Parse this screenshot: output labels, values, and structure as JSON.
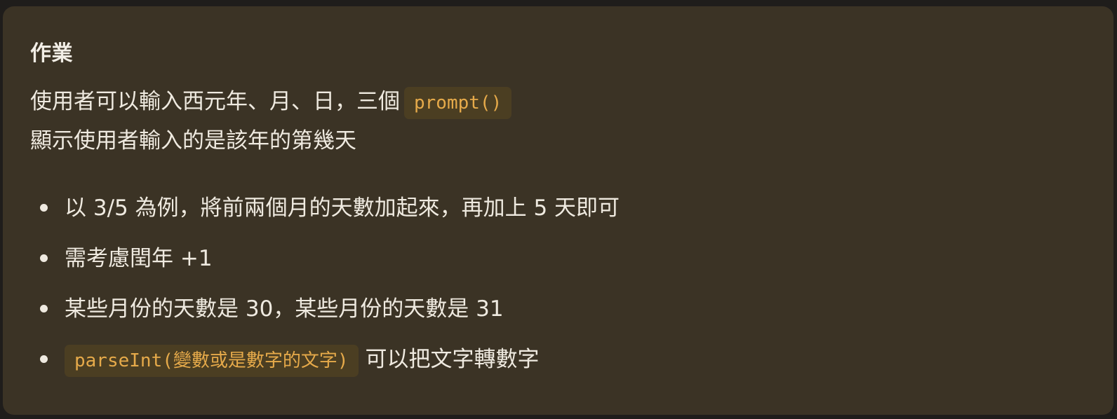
{
  "card": {
    "title": "作業",
    "line1_text": "使用者可以輸入西元年、月、日，三個",
    "line1_code": "prompt()",
    "line2_text": "顯示使用者輸入的是該年的第幾天"
  },
  "list": {
    "items": [
      {
        "text": "以 3/5 為例，將前兩個月的天數加起來，再加上 5 天即可"
      },
      {
        "text": "需考慮閏年 +1"
      },
      {
        "text": "某些月份的天數是 30，某些月份的天數是 31"
      },
      {
        "code": "parseInt(變數或是數字的文字)",
        "text": "可以把文字轉數字"
      }
    ]
  },
  "colors": {
    "page_background": "#1f1d1b",
    "card_background": "#3b3325",
    "code_background": "#4b3e22",
    "code_text": "#e6aa4a",
    "body_text": "#efeae0"
  }
}
